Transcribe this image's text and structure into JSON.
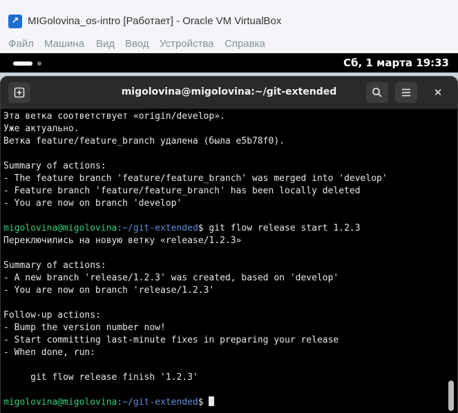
{
  "window": {
    "title": "MIGolovina_os-intro [Работает] - Oracle VM VirtualBox",
    "app_icon": "virtualbox-icon"
  },
  "menu": {
    "items": [
      "Файл",
      "Машина",
      "Вид",
      "Ввод",
      "Устройства",
      "Справка"
    ]
  },
  "topbar": {
    "clock": "Сб, 1 марта  19:33"
  },
  "terminal": {
    "title": "migolovina@migolovina:~/git-extended",
    "lines": [
      {
        "type": "text",
        "text": "Эта ветка соответствует «origin/develop»."
      },
      {
        "type": "text",
        "text": "Уже актуально."
      },
      {
        "type": "text",
        "text": "Ветка feature/feature_branch удалена (была e5b78f0)."
      },
      {
        "type": "text",
        "text": ""
      },
      {
        "type": "text",
        "text": "Summary of actions:"
      },
      {
        "type": "text",
        "text": "- The feature branch 'feature/feature_branch' was merged into 'develop'"
      },
      {
        "type": "text",
        "text": "- Feature branch 'feature/feature_branch' has been locally deleted"
      },
      {
        "type": "text",
        "text": "- You are now on branch 'develop'"
      },
      {
        "type": "text",
        "text": ""
      },
      {
        "type": "prompt",
        "user": "migolovina@migolovina",
        "path": ":~/git-extended",
        "cmd": "$ git flow release start 1.2.3"
      },
      {
        "type": "text",
        "text": "Переключились на новую ветку «release/1.2.3»"
      },
      {
        "type": "text",
        "text": ""
      },
      {
        "type": "text",
        "text": "Summary of actions:"
      },
      {
        "type": "text",
        "text": "- A new branch 'release/1.2.3' was created, based on 'develop'"
      },
      {
        "type": "text",
        "text": "- You are now on branch 'release/1.2.3'"
      },
      {
        "type": "text",
        "text": ""
      },
      {
        "type": "text",
        "text": "Follow-up actions:"
      },
      {
        "type": "text",
        "text": "- Bump the version number now!"
      },
      {
        "type": "text",
        "text": "- Start committing last-minute fixes in preparing your release"
      },
      {
        "type": "text",
        "text": "- When done, run:"
      },
      {
        "type": "text",
        "text": ""
      },
      {
        "type": "text",
        "text": "     git flow release finish '1.2.3'"
      },
      {
        "type": "text",
        "text": ""
      },
      {
        "type": "prompt",
        "user": "migolovina@migolovina",
        "path": ":~/git-extended",
        "cmd": "$"
      }
    ]
  },
  "colors": {
    "prompt_user": "#33d17a",
    "prompt_path": "#5e8fdd"
  }
}
